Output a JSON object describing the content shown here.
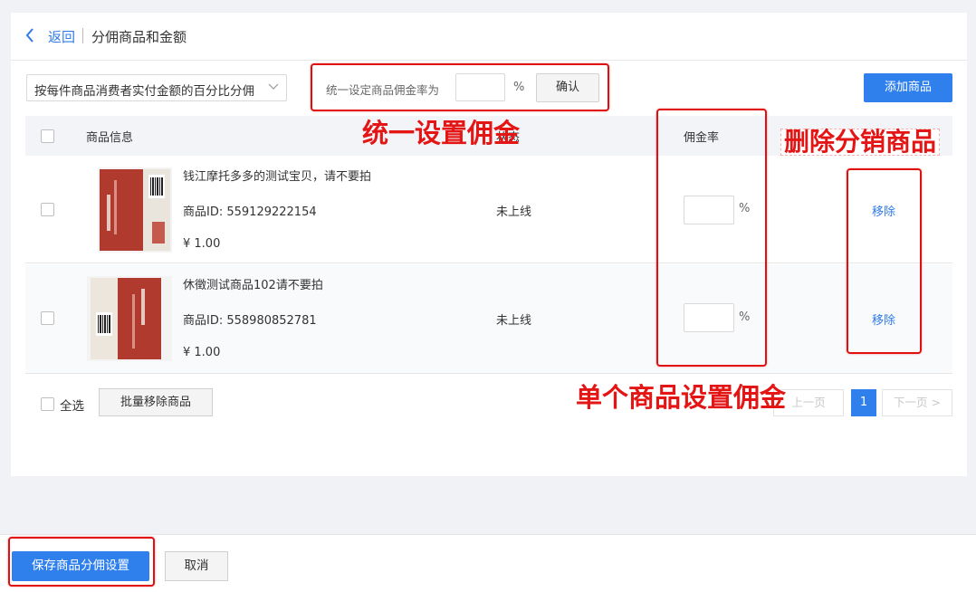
{
  "header": {
    "back_label": "返回",
    "title": "分佣商品和金额"
  },
  "toolbar": {
    "mode_select_value": "按每件商品消费者实付金额的百分比分佣",
    "unified_rate_label": "统一设定商品佣金率为",
    "unified_rate_value": "",
    "percent_sign": "%",
    "confirm_label": "确认",
    "add_product_label": "添加商品"
  },
  "table": {
    "columns": {
      "product_info": "商品信息",
      "status": "状态",
      "commission_rate": "佣金率"
    },
    "rows": [
      {
        "name": "钱江摩托多多的测试宝贝，请不要拍",
        "id": "商品ID: 559129222154",
        "price": "¥ 1.00",
        "status": "未上线",
        "rate": "",
        "action": "移除"
      },
      {
        "name": "休徵测试商品102请不要拍",
        "id": "商品ID: 558980852781",
        "price": "¥ 1.00",
        "status": "未上线",
        "rate": "",
        "action": "移除"
      }
    ]
  },
  "bottom": {
    "select_all_label": "全选",
    "batch_remove_label": "批量移除商品",
    "prev_label": "上一页",
    "current_page": "1",
    "next_label": "下一页 >"
  },
  "footer": {
    "save_label": "保存商品分佣设置",
    "cancel_label": "取消"
  },
  "annotations": {
    "unified": "统一设置佣金",
    "delete": "删除分销商品",
    "single": "单个商品设置佣金"
  },
  "colors": {
    "primary": "#2f80ed",
    "link": "#2f7be6",
    "annotation_red": "#e31515"
  }
}
